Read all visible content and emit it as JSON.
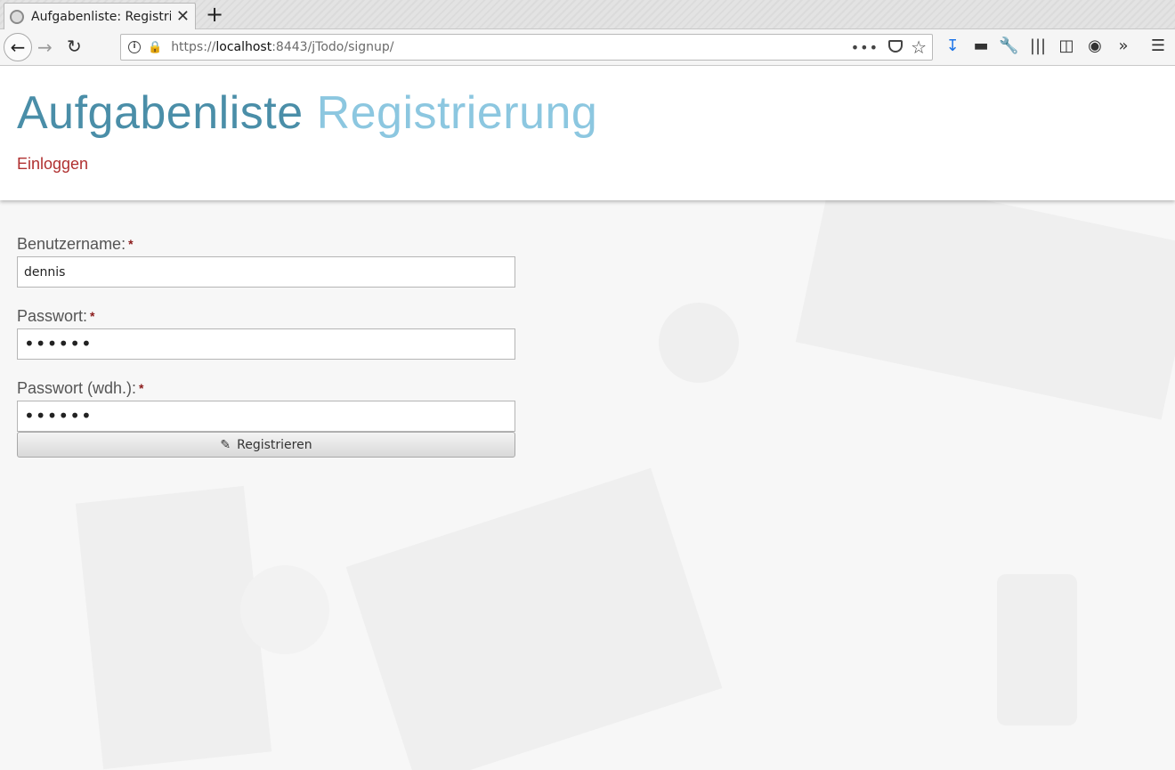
{
  "browser": {
    "tab_title": "Aufgabenliste: Registrierung",
    "tab_close": "✕",
    "new_tab": "+",
    "url_scheme": "https://",
    "url_host": "localhost",
    "url_rest": ":8443/jTodo/signup/",
    "icons": [
      "back-icon",
      "forward-icon",
      "reload-icon",
      "info-icon",
      "lock-warning-icon",
      "page-actions-icon",
      "pocket-icon",
      "bookmark-star-icon",
      "download-icon",
      "extension-icon",
      "wrench-icon",
      "library-icon",
      "sidebar-icon",
      "gnome-icon",
      "overflow-icon",
      "menu-icon"
    ]
  },
  "header": {
    "title_main": "Aufgabenliste",
    "title_sub": "Registrierung",
    "login_link": "Einloggen",
    "colors": {
      "title_main": "#4a8ea8",
      "title_sub": "#8cc7e0",
      "link": "#b03030"
    }
  },
  "form": {
    "username_label": "Benutzername:",
    "username_value": "dennis",
    "password_label": "Passwort:",
    "password_value": "••••••",
    "password_repeat_label": "Passwort (wdh.):",
    "password_repeat_value": "••••••",
    "required_mark": "*",
    "submit_label": "Registrieren"
  }
}
